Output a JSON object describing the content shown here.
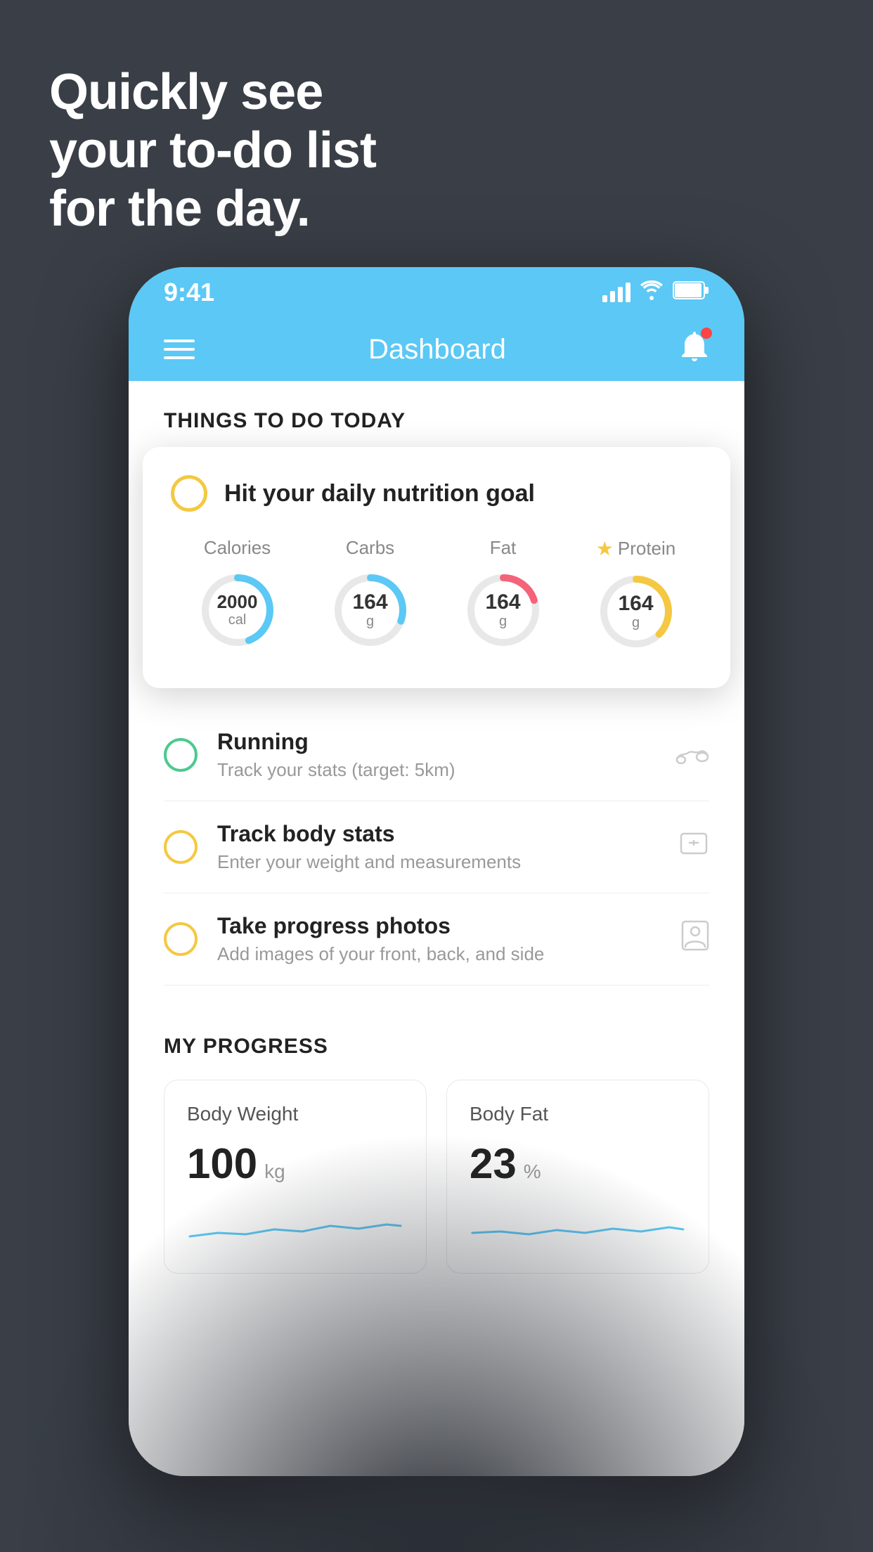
{
  "headline": {
    "line1": "Quickly see",
    "line2": "your to-do list",
    "line3": "for the day."
  },
  "status_bar": {
    "time": "9:41",
    "signal": "signal",
    "wifi": "wifi",
    "battery": "battery"
  },
  "nav": {
    "title": "Dashboard"
  },
  "things_today": {
    "header": "THINGS TO DO TODAY"
  },
  "nutrition_card": {
    "title": "Hit your daily nutrition goal",
    "stats": [
      {
        "label": "Calories",
        "value": "2000",
        "unit": "cal",
        "color": "#5bc8f5",
        "starred": false
      },
      {
        "label": "Carbs",
        "value": "164",
        "unit": "g",
        "color": "#5bc8f5",
        "starred": false
      },
      {
        "label": "Fat",
        "value": "164",
        "unit": "g",
        "color": "#f5637a",
        "starred": false
      },
      {
        "label": "Protein",
        "value": "164",
        "unit": "g",
        "color": "#f5c842",
        "starred": true
      }
    ]
  },
  "todo_items": [
    {
      "name": "Running",
      "desc": "Track your stats (target: 5km)",
      "circle_color": "green",
      "icon": "👟"
    },
    {
      "name": "Track body stats",
      "desc": "Enter your weight and measurements",
      "circle_color": "yellow",
      "icon": "⚖️"
    },
    {
      "name": "Take progress photos",
      "desc": "Add images of your front, back, and side",
      "circle_color": "yellow",
      "icon": "👤"
    }
  ],
  "my_progress": {
    "header": "MY PROGRESS",
    "cards": [
      {
        "title": "Body Weight",
        "value": "100",
        "unit": "kg"
      },
      {
        "title": "Body Fat",
        "value": "23",
        "unit": "%"
      }
    ]
  }
}
